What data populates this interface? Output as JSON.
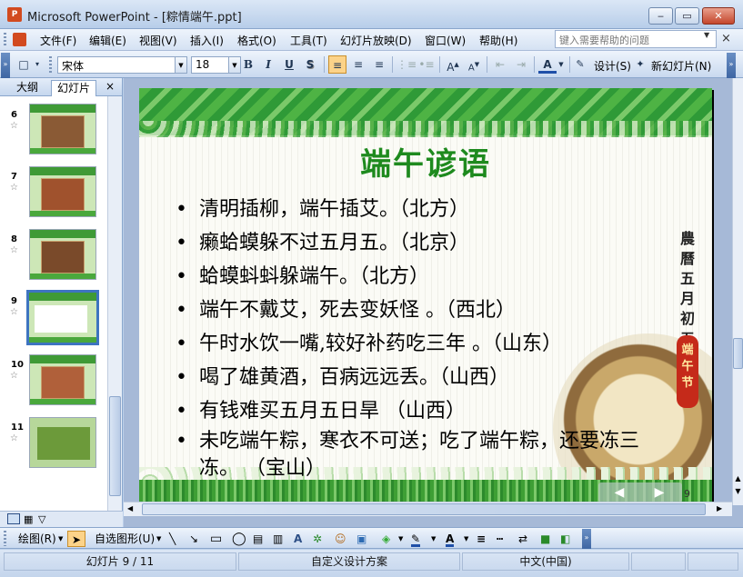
{
  "window": {
    "app_icon": "P",
    "title": "Microsoft PowerPoint - [粽情端午.ppt]",
    "minimize_icon": "minimize-icon",
    "restore_icon": "restore-icon",
    "close_icon": "close-icon"
  },
  "menubar": {
    "items": [
      "文件(F)",
      "编辑(E)",
      "视图(V)",
      "插入(I)",
      "格式(O)",
      "工具(T)",
      "幻灯片放映(D)",
      "窗口(W)",
      "帮助(H)"
    ],
    "help_placeholder": "键入需要帮助的问题",
    "doc_close": "×"
  },
  "toolbar": {
    "font_name": "宋体",
    "font_size": "18",
    "bold": "B",
    "italic": "I",
    "underline": "U",
    "shadow": "S",
    "design_label": "设计(S)",
    "new_slide_label": "新幻灯片(N)",
    "active_button": "align-left"
  },
  "outline_pane": {
    "tabs": [
      "大纲",
      "幻灯片"
    ],
    "active_tab": "幻灯片",
    "close": "×",
    "slides": [
      {
        "number": "6",
        "star": "☆"
      },
      {
        "number": "7",
        "star": "☆"
      },
      {
        "number": "8",
        "star": "☆"
      },
      {
        "number": "9",
        "star": "☆",
        "selected": true
      },
      {
        "number": "10",
        "star": "☆"
      },
      {
        "number": "11",
        "star": "☆"
      }
    ]
  },
  "slide": {
    "title": "端午谚语",
    "bullets": [
      "清明插柳，端午插艾。（北方）",
      "癞蛤蟆躲不过五月五。（北京）",
      "蛤蟆蚪蚪躲端午。（北方）",
      "端午不戴艾，死去变妖怪 。（西北）",
      "午时水饮一嘴,较好补药吃三年 。（山东）",
      "喝了雄黄酒，百病远远丢。（山西）",
      "有钱难买五月五日旱 （山西）",
      "未吃端午粽，寒衣不可送；吃了端午粽，还要冻三冻。 （宝山）"
    ],
    "side_text": "農曆五月初五",
    "badge_text": "端午节",
    "page_number": "9",
    "nav_prev": "◀",
    "nav_next": "▶"
  },
  "drawing_toolbar": {
    "draw_label": "绘图(R)",
    "autoshape_label": "自选图形(U)"
  },
  "status": {
    "slide_info": "幻灯片 9 / 11",
    "design": "自定义设计方案",
    "language": "中文(中国)"
  },
  "colors": {
    "accent_green": "#1e8a1e",
    "selection_blue": "#3e74c0",
    "toolbar_active": "#fcd389"
  }
}
